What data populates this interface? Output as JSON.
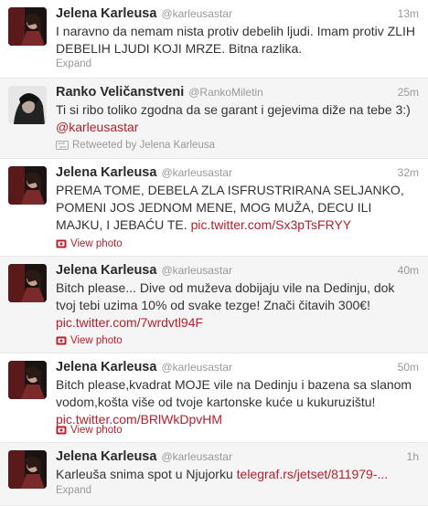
{
  "tweets": [
    {
      "name": "Jelena Karleusa",
      "handle": "@karleusastar",
      "time": "13m",
      "text": "I naravno da nemam nista protiv debelih ljudi. Imam protiv ZLIH DEBELIH LJUDI KOJI MRZE. Bitna razlika.",
      "action": "Expand"
    },
    {
      "name": "Ranko Veličanstveni",
      "handle": "@RankoMiletin",
      "time": "25m",
      "text": "Ti si ribo toliko zgodna da se garant i gejevima diže na tebe 3:)",
      "mention": "@karleusastar",
      "retweet": "Retweeted by Jelena Karleusa"
    },
    {
      "name": "Jelena Karleusa",
      "handle": "@karleusastar",
      "time": "32m",
      "text": "PREMA TOME, DEBELA ZLA ISFRUSTRIRANA SELJANKO, POMENI JOS JEDNOM MENE, MOG MUŽA, DECU ILI MAJKU, I JEBAĆU TE.",
      "link": "pic.twitter.com/Sx3pTsFRYY",
      "action": "View photo"
    },
    {
      "name": "Jelena Karleusa",
      "handle": "@karleusastar",
      "time": "40m",
      "text": "Bitch please... Dive od muževa dobijaju vile na Dedinju, dok tvoj tebi uzima 10% od svake tezge! Znači čitavih 300€!",
      "link": "pic.twitter.com/7wrdvtl94F",
      "action": "View photo"
    },
    {
      "name": "Jelena Karleusa",
      "handle": "@karleusastar",
      "time": "50m",
      "text": "Bitch please,kvadrat MOJE vile na Dedinju i bazena sa slanom vodom,košta više od tvoje kartonske kuće u kukuruzištu!",
      "link": "pic.twitter.com/BRlWkDpvHM",
      "action": "View photo"
    },
    {
      "name": "Jelena Karleusa",
      "handle": "@karleusastar",
      "time": "1h",
      "text": "Karleuša snima spot u Njujorku",
      "link": "telegraf.rs/jetset/811979-...",
      "action": "Expand"
    }
  ],
  "colors": {
    "link": "#b4202e",
    "muted": "#999999"
  },
  "icons": {
    "retweet": "retweet-icon",
    "photo": "photo-icon"
  }
}
